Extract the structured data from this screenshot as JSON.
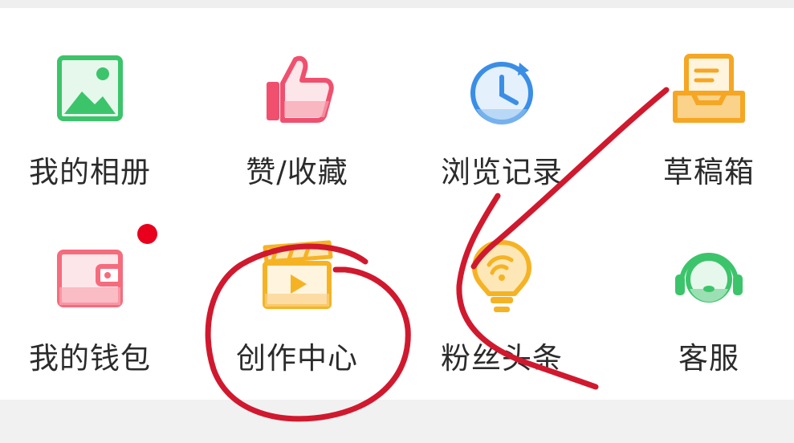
{
  "grid": {
    "items": [
      {
        "label": "我的相册",
        "icon": "photo-album-icon"
      },
      {
        "label": "赞/收藏",
        "icon": "thumbs-up-icon"
      },
      {
        "label": "浏览记录",
        "icon": "history-clock-icon"
      },
      {
        "label": "草稿箱",
        "icon": "drafts-tray-icon"
      },
      {
        "label": "我的钱包",
        "icon": "wallet-icon"
      },
      {
        "label": "创作中心",
        "icon": "creation-clapperboard-icon"
      },
      {
        "label": "粉丝头条",
        "icon": "fans-headline-bulb-icon"
      },
      {
        "label": "客服",
        "icon": "customer-service-headset-icon"
      }
    ]
  },
  "colors": {
    "album_green": "#3cc46b",
    "like_red": "#f0506e",
    "clock_blue": "#3a8ee6",
    "drafts_orange": "#f5a623",
    "wallet_pink": "#f56c7d",
    "clapper_orange": "#f5b324",
    "bulb_yellow": "#f5b324",
    "service_green": "#3cc46b",
    "badge_red": "#e8001c",
    "annotation_red": "#d0192e"
  }
}
